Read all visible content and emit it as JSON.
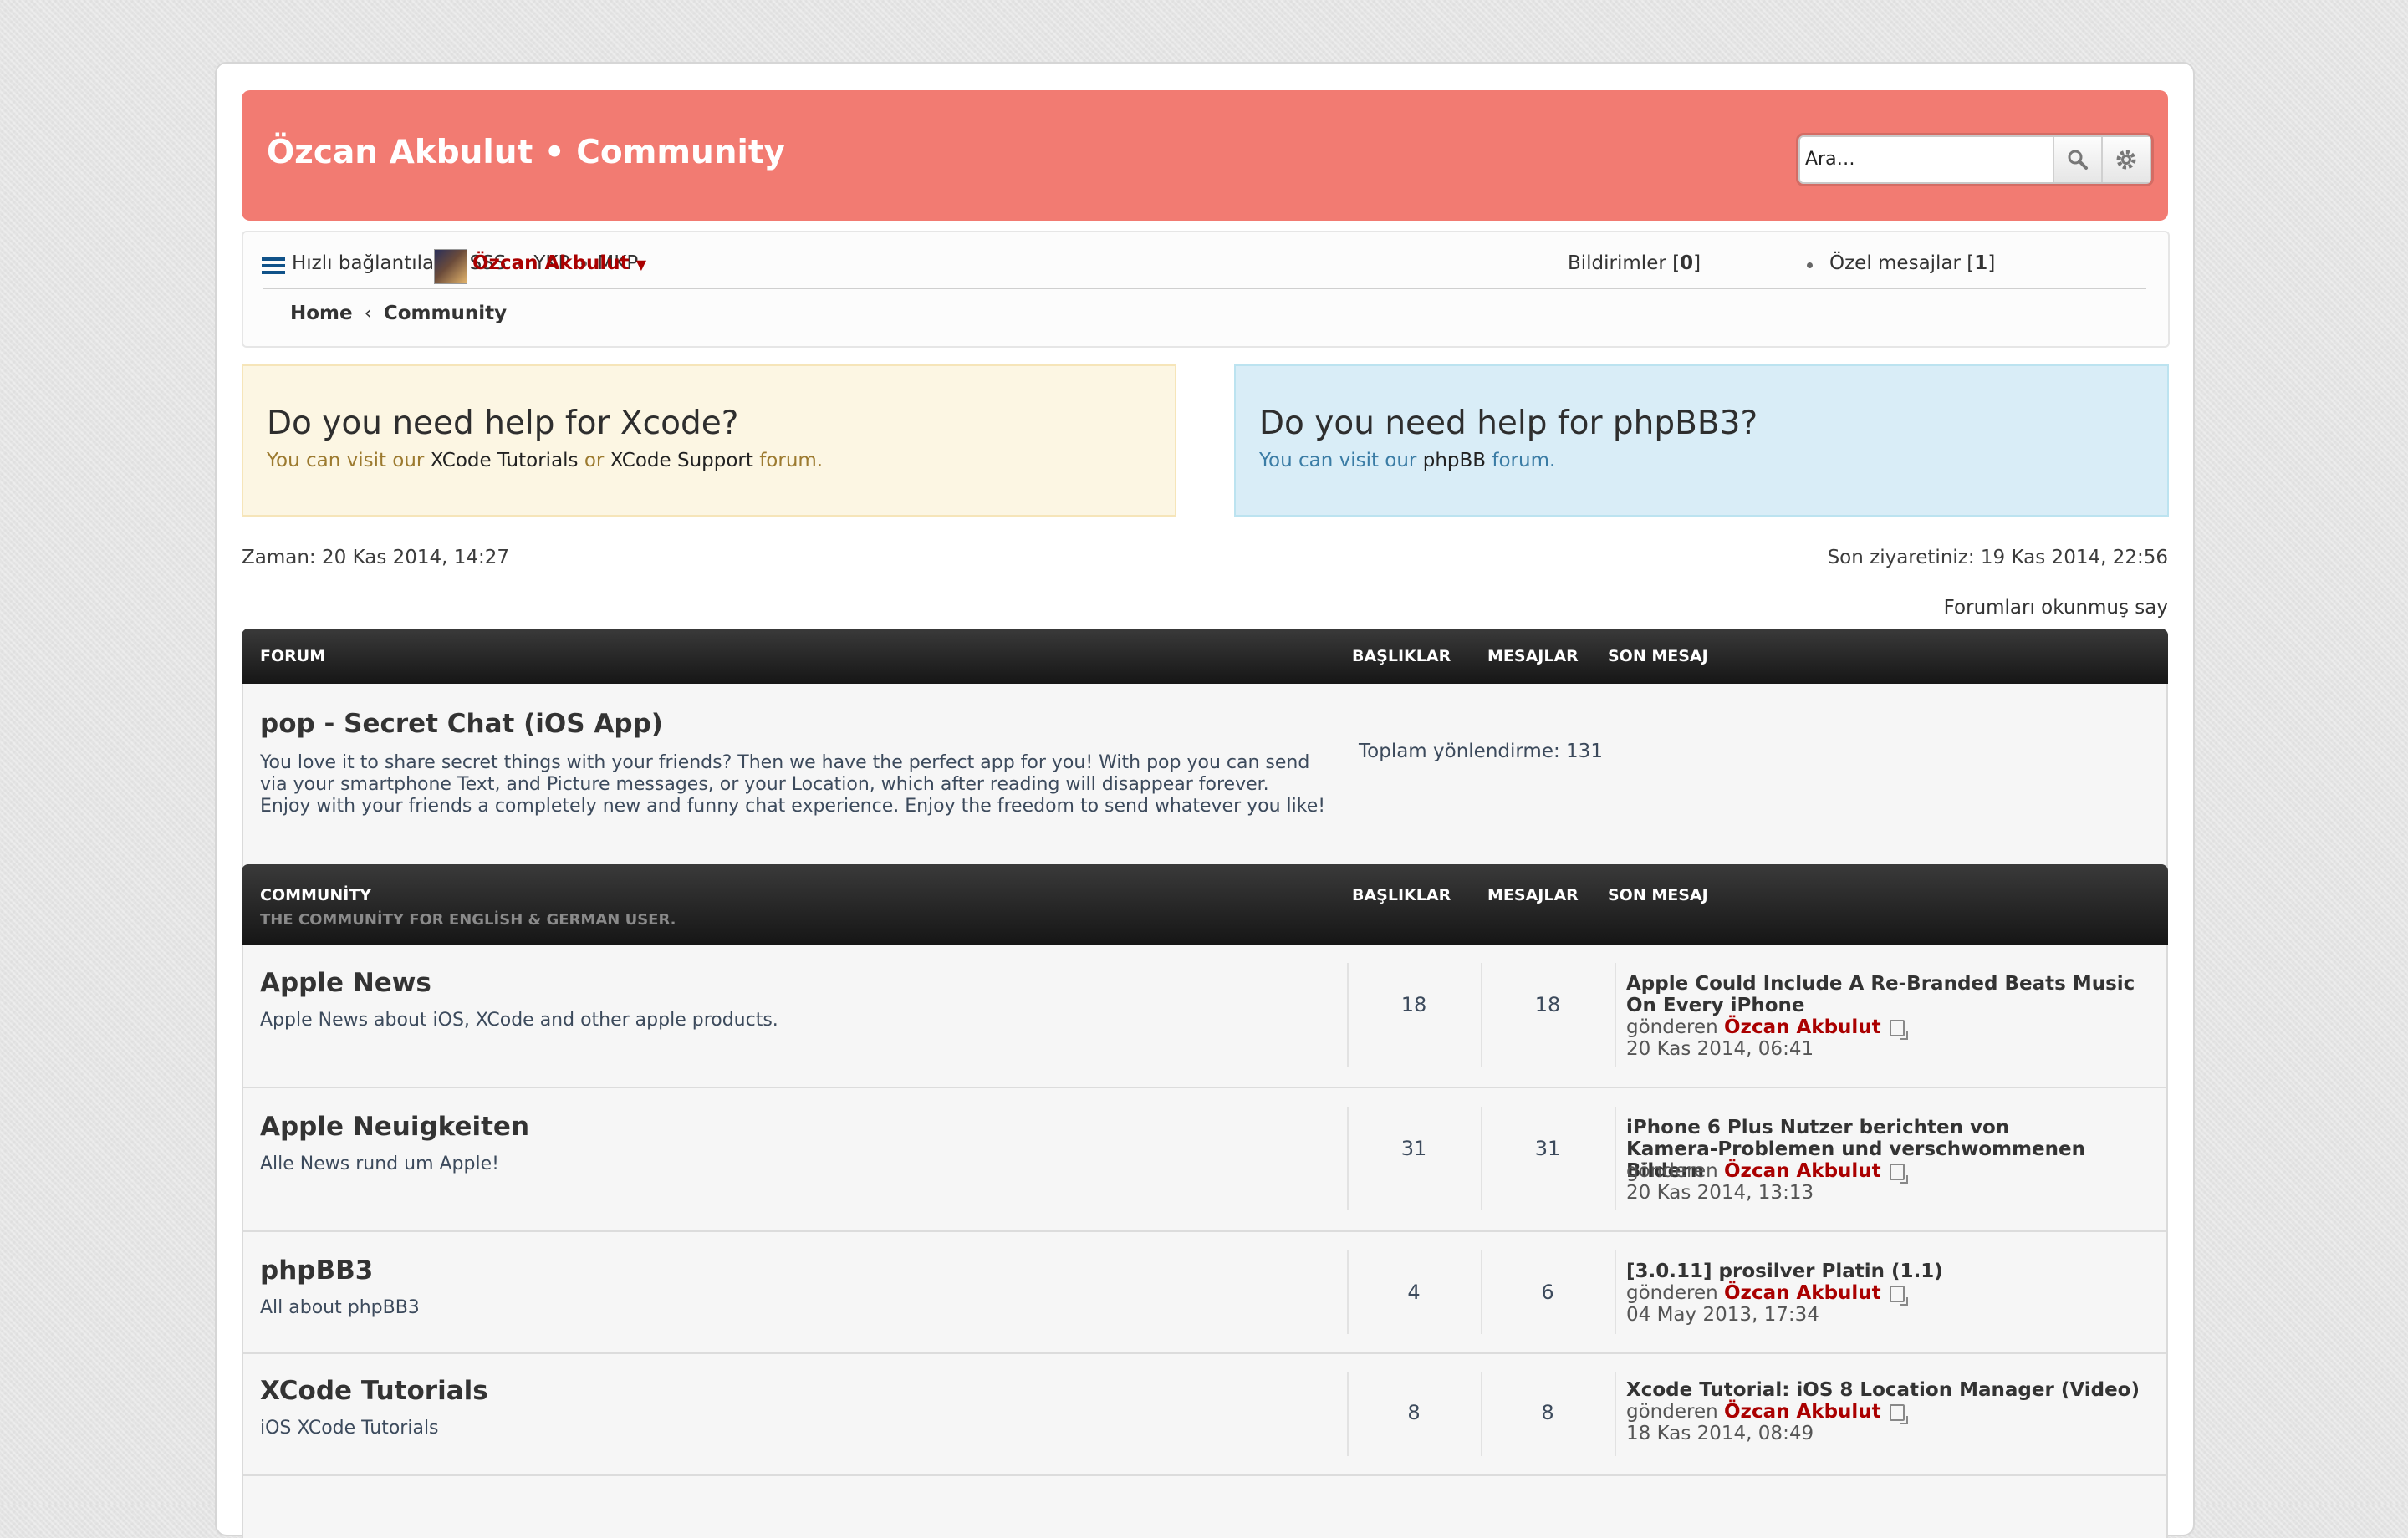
{
  "header": {
    "title": "Özcan Akbulut • Community",
    "search_placeholder": "Ara…",
    "accent": "#f27b72"
  },
  "nav": {
    "quick_links": "Hızlı bağlantılar",
    "links": [
      "SSS",
      "YKP",
      "MKP"
    ],
    "notifications_label": "Bildirimler",
    "notifications_count": "0",
    "messages_label": "Özel mesajlar",
    "messages_count": "1",
    "user": "Özcan Akbulut",
    "breadcrumb": [
      "Home",
      "Community"
    ]
  },
  "promo": {
    "xcode": {
      "heading": "Do you need help for Xcode?",
      "prefix": "You can visit our",
      "link1": "XCode Tutorials",
      "mid": "or",
      "link2": "XCode Support",
      "suffix": "forum."
    },
    "phpbb": {
      "heading": "Do you need help for phpBB3?",
      "prefix": "You can visit our",
      "link1": "phpBB",
      "suffix": "forum."
    }
  },
  "meta": {
    "current_time": "Zaman: 20 Kas 2014, 14:27",
    "last_visit": "Son ziyaretiniz: 19 Kas 2014, 22:56",
    "mark_read": "Forumları okunmuş say"
  },
  "table_forum": {
    "col_forum": "FORUM",
    "col_topics": "BAŞLIKLAR",
    "col_posts": "MESAJLAR",
    "col_last": "SON MESAJ",
    "row": {
      "title": "pop - Secret Chat (iOS App)",
      "desc": [
        "You love it to share secret things with your friends? Then we have the perfect app for you! With pop you can send",
        "via your smartphone Text, and Picture messages, or your Location, which after reading will disappear forever.",
        "Enjoy with your friends a completely new and funny chat experience. Enjoy the freedom to send whatever you like!"
      ],
      "redirects": "Toplam yönlendirme: 131"
    }
  },
  "table_community": {
    "col_forum": "COMMUNİTY",
    "subtitle": "THE COMMUNİTY FOR ENGLİSH & GERMAN USER.",
    "col_topics": "BAŞLIKLAR",
    "col_posts": "MESAJLAR",
    "col_last": "SON MESAJ",
    "posted_by": "gönderen",
    "rows": [
      {
        "title": "Apple News",
        "desc": "Apple News about iOS, XCode and other apple products.",
        "topics": "18",
        "posts": "18",
        "last_title": "Apple Could Include A Re-Branded Beats Music On Every iPhone",
        "last_user": "Özcan Akbulut",
        "last_date": "20 Kas 2014, 06:41"
      },
      {
        "title": "Apple Neuigkeiten",
        "desc": "Alle News rund um Apple!",
        "topics": "31",
        "posts": "31",
        "last_title": "iPhone 6 Plus Nutzer berichten von Kamera-Problemen und verschwommenen Bildern",
        "last_user": "Özcan Akbulut",
        "last_date": "20 Kas 2014, 13:13"
      },
      {
        "title": "phpBB3",
        "desc": "All about phpBB3",
        "topics": "4",
        "posts": "6",
        "last_title": "[3.0.11] prosilver Platin (1.1)",
        "last_user": "Özcan Akbulut",
        "last_date": "04 May 2013, 17:34"
      },
      {
        "title": "XCode Tutorials",
        "desc": "iOS XCode Tutorials",
        "topics": "8",
        "posts": "8",
        "last_title": "Xcode Tutorial: iOS 8 Location Manager (Video)",
        "last_user": "Özcan Akbulut",
        "last_date": "18 Kas 2014, 08:49"
      }
    ]
  }
}
